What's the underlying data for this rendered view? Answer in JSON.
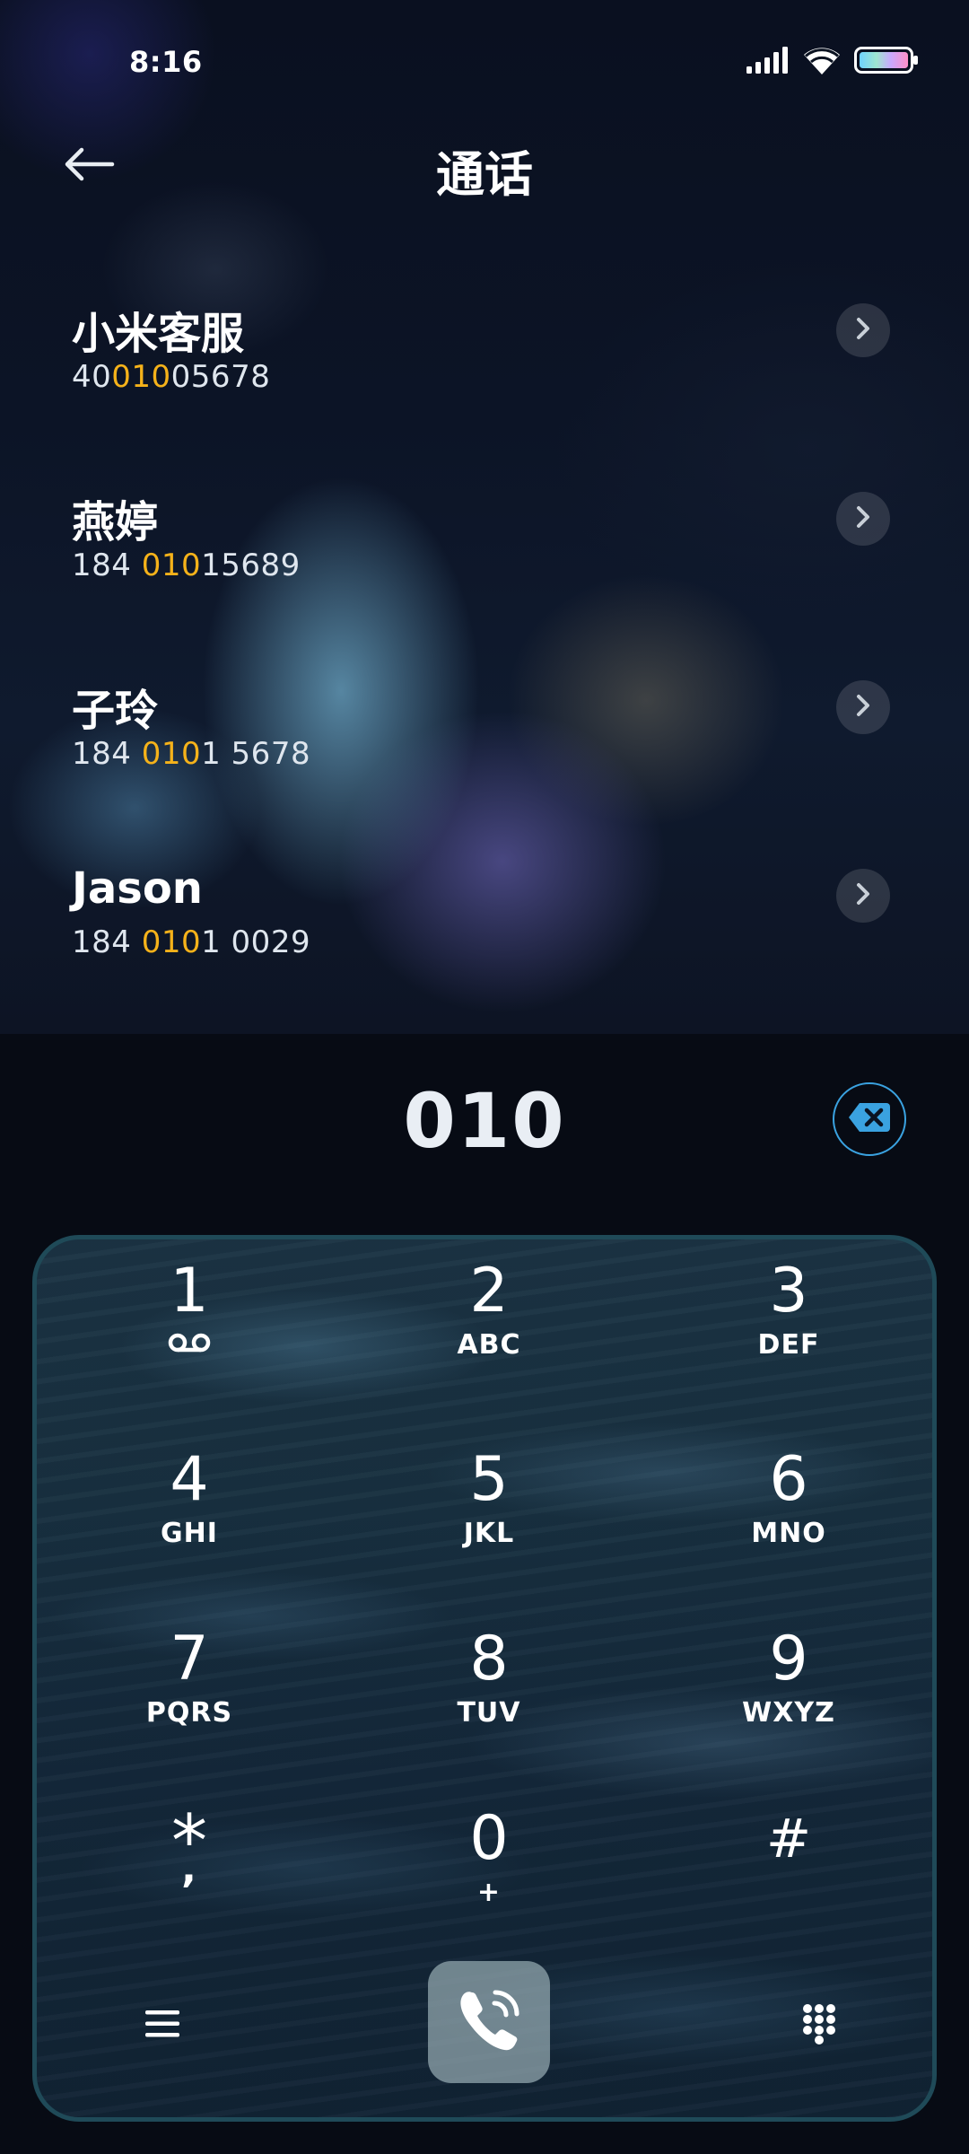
{
  "status_bar": {
    "time": "8:16",
    "icons": [
      "signal-icon",
      "wifi-icon",
      "battery-icon"
    ]
  },
  "header": {
    "title": "通话",
    "back_icon": "arrow-left-icon"
  },
  "contacts": [
    {
      "name": "小米客服",
      "number_pre": "40",
      "number_match": "010",
      "number_post": "05678"
    },
    {
      "name": "燕婷",
      "number_pre": "184 ",
      "number_match": "010",
      "number_post": "15689"
    },
    {
      "name": "子玲",
      "number_pre": "184 ",
      "number_match": "010",
      "number_post": "1 5678"
    },
    {
      "name": "Jason",
      "number_pre": "184 ",
      "number_match": "010",
      "number_post": "1 0029"
    }
  ],
  "dialer": {
    "number": "010",
    "backspace_icon": "backspace-icon"
  },
  "keypad": {
    "keys": [
      {
        "digit": "1",
        "letters": ""
      },
      {
        "digit": "2",
        "letters": "ABC"
      },
      {
        "digit": "3",
        "letters": "DEF"
      },
      {
        "digit": "4",
        "letters": "GHI"
      },
      {
        "digit": "5",
        "letters": "JKL"
      },
      {
        "digit": "6",
        "letters": "MNO"
      },
      {
        "digit": "7",
        "letters": "PQRS"
      },
      {
        "digit": "8",
        "letters": "TUV"
      },
      {
        "digit": "9",
        "letters": "WXYZ"
      },
      {
        "digit": "*",
        "letters": ","
      },
      {
        "digit": "0",
        "letters": "+"
      },
      {
        "digit": "#",
        "letters": ""
      }
    ],
    "bottom": {
      "menu_icon": "menu-icon",
      "call_icon": "phone-call-icon",
      "keypad_icon": "dialpad-icon"
    }
  },
  "colors": {
    "highlight": "#f5b21a",
    "accent": "#3aa2e0",
    "panel_border": "#1f4a58"
  }
}
